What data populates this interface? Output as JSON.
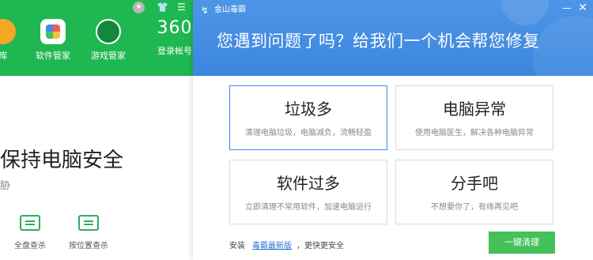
{
  "background_app": {
    "nav": [
      {
        "label": "库"
      },
      {
        "label": "软件管家"
      },
      {
        "label": "游戏管家"
      },
      {
        "label": "登录帐号",
        "logo_text": "360"
      }
    ],
    "main": {
      "title": "保持电脑安全",
      "subtitle": "胁"
    },
    "tools": [
      {
        "label": "全盘查杀"
      },
      {
        "label": "按位置查杀"
      }
    ]
  },
  "popup": {
    "app_name": "金山毒霸",
    "minimize_symbol": "—",
    "close_symbol": "✕",
    "headline": "您遇到问题了吗？给我们一个机会帮您修复",
    "options": [
      {
        "title": "垃圾多",
        "desc": "清理电脑垃圾，电脑减负，流畅轻盈"
      },
      {
        "title": "电脑异常",
        "desc": "使用电脑医生，解决各种电脑异常"
      },
      {
        "title": "软件过多",
        "desc": "立即清理不常用软件，加速电脑运行"
      },
      {
        "title": "分手吧",
        "desc": "不想要你了，有缘再见吧"
      }
    ],
    "footer": {
      "install_text": "安装",
      "link_text": "毒霸最新版",
      "suffix_text": "，更快更安全"
    },
    "primary_button": "一键清理"
  },
  "colors": {
    "bg_green": "#1fb751",
    "popup_blue": "#3c86e0",
    "button_green": "#45c15a",
    "link_blue": "#2d6fd6",
    "selected_border": "#3a8ee6"
  },
  "icons": [
    "star-icon",
    "shirt-icon",
    "menu-icon",
    "kingsoft-logo-icon"
  ]
}
